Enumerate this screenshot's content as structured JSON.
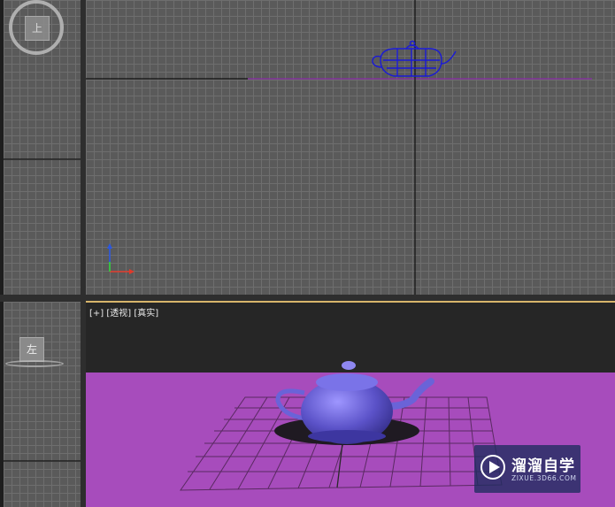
{
  "viewports": {
    "top_left_cube_label": "上",
    "bottom_left_cube_label": "左",
    "perspective": {
      "bracket_plus": "[+]",
      "mode": "[透视]",
      "shading": "[真实]"
    }
  },
  "watermark": {
    "name": "溜溜自学",
    "url": "ZIXUE.3D66.COM"
  },
  "colors": {
    "grid_bg": "#5a5a5a",
    "grid_line": "#6e6e6e",
    "persp_ground": "#a74cbc",
    "teapot": "#5b52c8",
    "active_border": "#d7b56a",
    "wireframe": "#1a1ad6"
  },
  "icons": [
    "viewcube-icon",
    "axis-tripod-icon",
    "teapot-wireframe-icon",
    "teapot-shaded-icon",
    "watermark-logo-icon"
  ]
}
